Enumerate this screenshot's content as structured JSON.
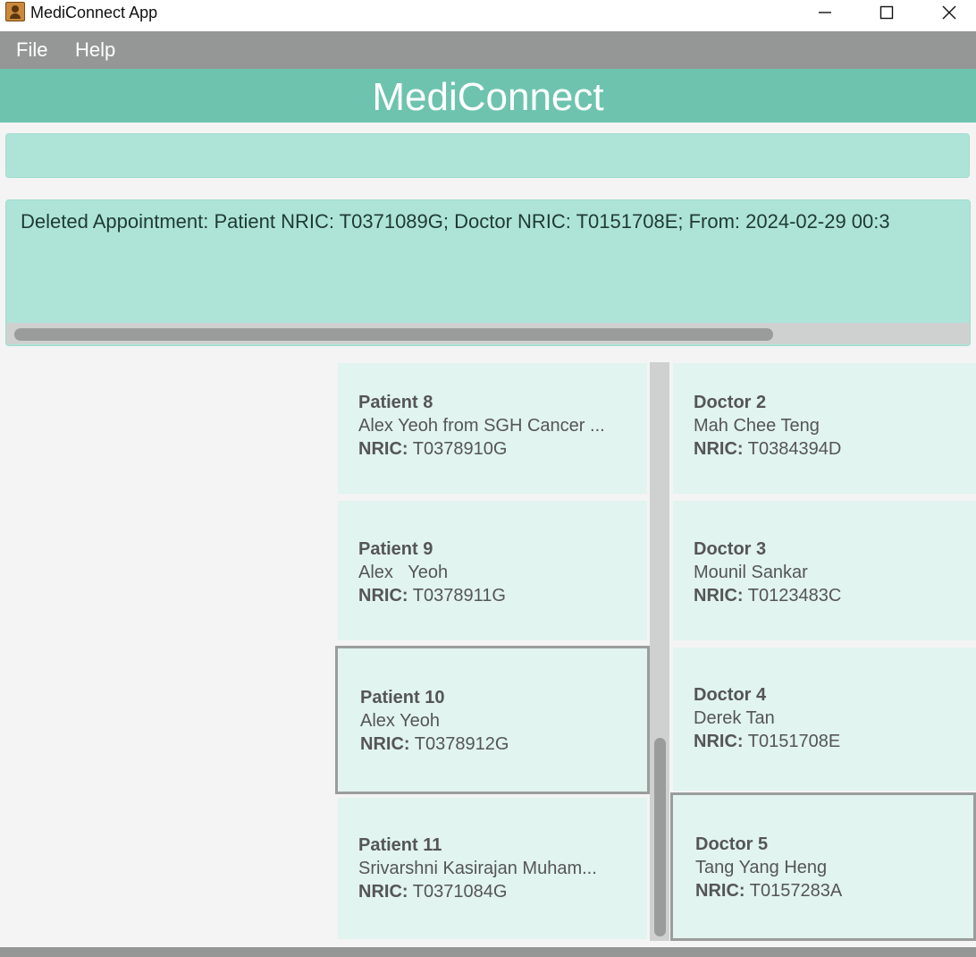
{
  "window": {
    "title": "MediConnect App"
  },
  "menu": {
    "file": "File",
    "help": "Help"
  },
  "header": {
    "title": "MediConnect"
  },
  "command_box": {
    "value": ""
  },
  "result": {
    "text": "Deleted Appointment: Patient NRIC: T0371089G; Doctor NRIC: T0151708E; From: 2024-02-29 00:3"
  },
  "patients": [
    {
      "title": "Patient 8",
      "name": "Alex Yeoh from SGH Cancer ...",
      "nric_label": "NRIC:",
      "nric": "T0378910G"
    },
    {
      "title": "Patient 9",
      "name": "Alex   Yeoh",
      "nric_label": "NRIC:",
      "nric": "T0378911G"
    },
    {
      "title": "Patient 10",
      "name": "Alex Yeoh",
      "nric_label": "NRIC:",
      "nric": "T0378912G",
      "selected": true
    },
    {
      "title": "Patient 11",
      "name": "Srivarshni Kasirajan Muham...",
      "nric_label": "NRIC:",
      "nric": "T0371084G"
    }
  ],
  "doctors": [
    {
      "title": "Doctor 2",
      "name": "Mah Chee Teng",
      "nric_label": "NRIC:",
      "nric": "T0384394D"
    },
    {
      "title": "Doctor 3",
      "name": "Mounil Sankar",
      "nric_label": "NRIC:",
      "nric": "T0123483C"
    },
    {
      "title": "Doctor 4",
      "name": "Derek Tan",
      "nric_label": "NRIC:",
      "nric": "T0151708E"
    },
    {
      "title": "Doctor 5",
      "name": "Tang Yang Heng",
      "nric_label": "NRIC:",
      "nric": "T0157283A",
      "selected": true
    }
  ],
  "icons": {
    "app": "app-user-icon",
    "minimize": "minimize-icon",
    "maximize": "maximize-icon",
    "close": "close-icon"
  },
  "colors": {
    "header": "#6ec3af",
    "panel": "#aee4d8",
    "card": "#e1f4ef",
    "menubar": "#959796"
  }
}
